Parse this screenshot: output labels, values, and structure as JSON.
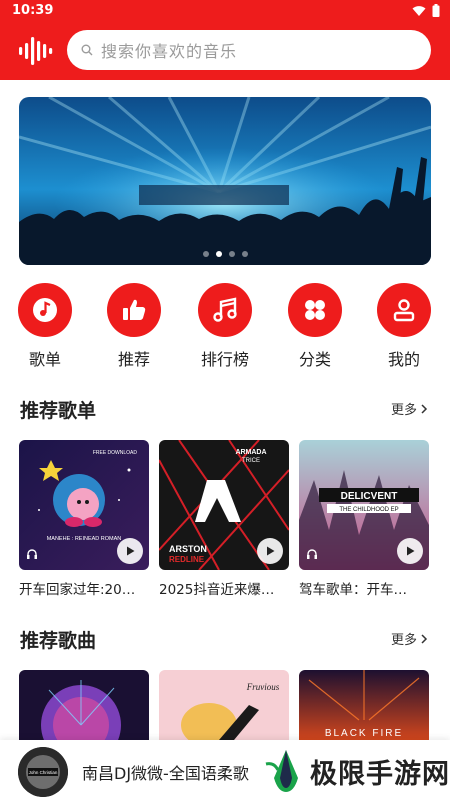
{
  "status": {
    "time": "10:39"
  },
  "search": {
    "placeholder": "搜索你喜欢的音乐"
  },
  "banner": {
    "dots": 4,
    "active_dot": 1
  },
  "nav": [
    {
      "label": "歌单",
      "icon": "music-note-icon"
    },
    {
      "label": "推荐",
      "icon": "thumbs-up-icon"
    },
    {
      "label": "排行榜",
      "icon": "chart-list-icon"
    },
    {
      "label": "分类",
      "icon": "grid-icon"
    },
    {
      "label": "我的",
      "icon": "user-icon"
    }
  ],
  "playlists": {
    "title": "推荐歌单",
    "more": "更多",
    "items": [
      {
        "title": "开车回家过年:20…",
        "cover_text": "MANEHE : REINEAD ROMAN"
      },
      {
        "title": "2025抖音近来爆…",
        "cover_text_1": "ARMADA",
        "cover_text_2": "TRICE",
        "cover_text_3": "ARSTON",
        "cover_text_4": "REDLINE"
      },
      {
        "title": "驾车歌单：开车…",
        "cover_text_1": "DELICVENT",
        "cover_text_2": "THE CHILDHOOD EP"
      }
    ]
  },
  "songs": {
    "title": "推荐歌曲",
    "more": "更多",
    "cover_texts": [
      "Fruvious",
      "BLACK FIRE"
    ]
  },
  "player": {
    "title": "南昌DJ微微-全国语柔歌",
    "disc_text": "John Christian"
  },
  "watermark": {
    "text": "极限手游网"
  },
  "colors": {
    "brand": "#ee1c1c"
  }
}
